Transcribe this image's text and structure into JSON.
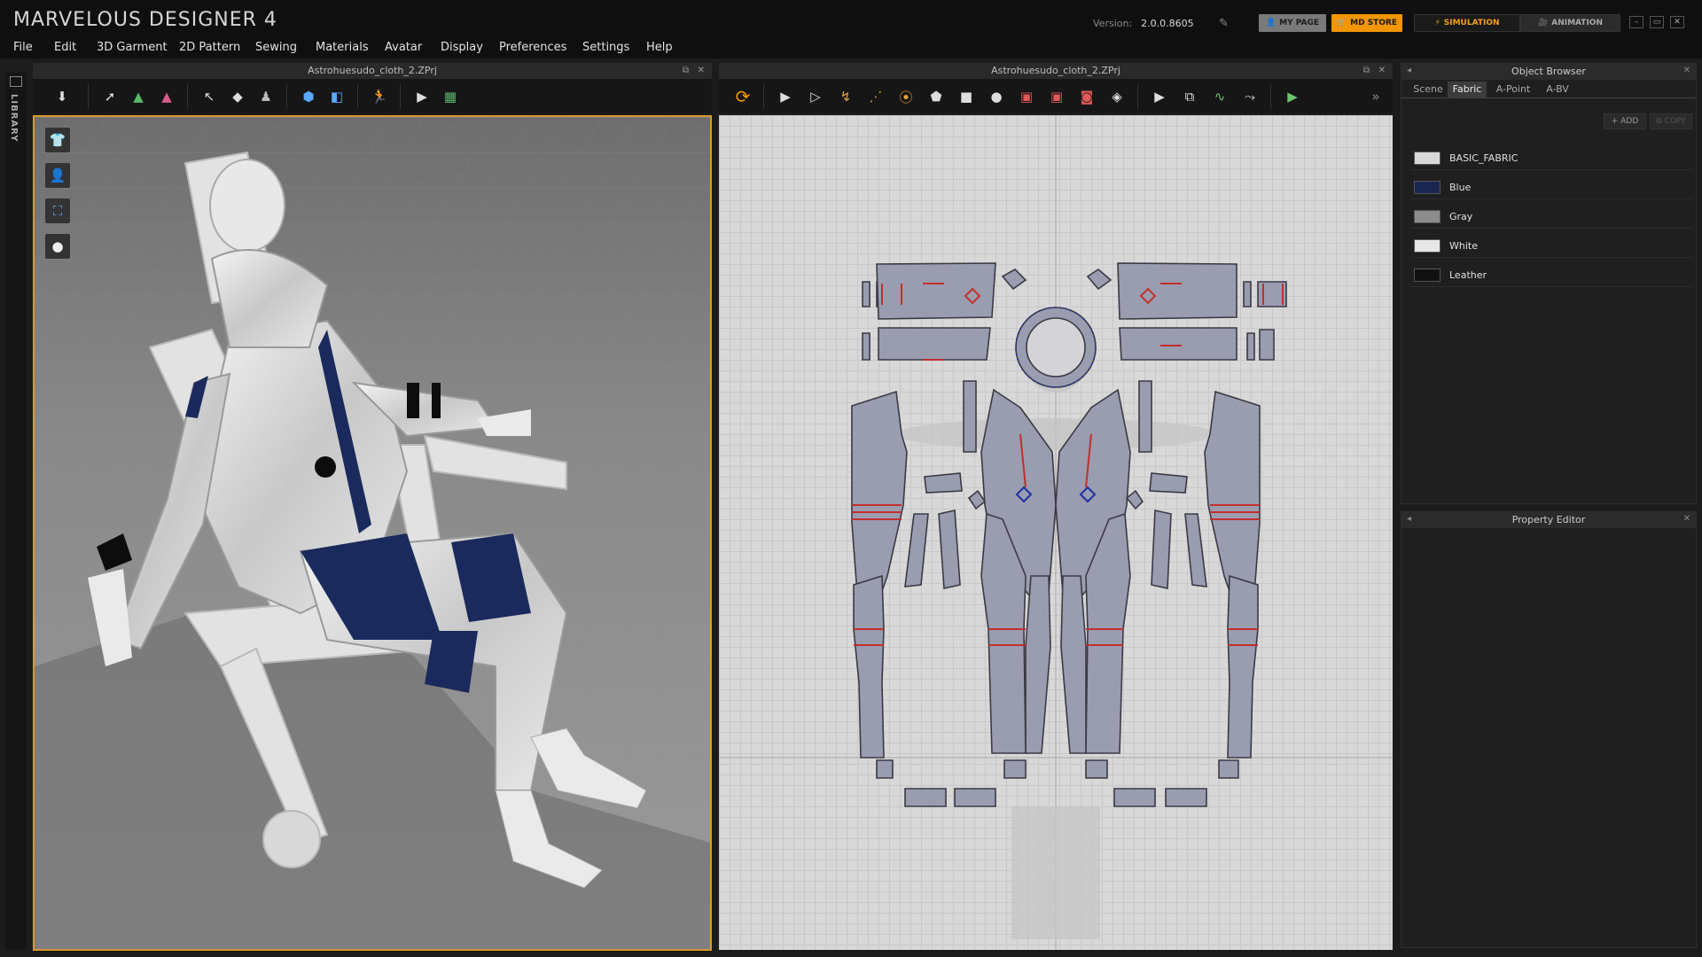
{
  "app": {
    "title": "MARVELOUS DESIGNER 4",
    "version_label": "Version:",
    "version": "2.0.0.8605",
    "buttons": {
      "my_page": "MY PAGE",
      "md_store": "MD STORE",
      "simulation": "SIMULATION",
      "animation": "ANIMATION"
    }
  },
  "menu": [
    "File",
    "Edit",
    "3D Garment",
    "2D Pattern",
    "Sewing",
    "Materials",
    "Avatar",
    "Display",
    "Preferences",
    "Settings",
    "Help"
  ],
  "library": {
    "label": "LIBRARY"
  },
  "panel3d": {
    "title": "Astrohuesudo_cloth_2.ZPrj"
  },
  "panel2d": {
    "title": "Astrohuesudo_cloth_2.ZPrj"
  },
  "object_browser": {
    "title": "Object Browser",
    "tabs": [
      "Scene",
      "Fabric",
      "A-Point",
      "A-BV"
    ],
    "active_tab": "Fabric",
    "add_label": "ADD",
    "copy_label": "COPY",
    "fabrics": [
      {
        "name": "BASIC_FABRIC",
        "color": "#d9d9d9"
      },
      {
        "name": "Blue",
        "color": "#1a2550"
      },
      {
        "name": "Gray",
        "color": "#8c8c8c"
      },
      {
        "name": "White",
        "color": "#e6e6e6"
      },
      {
        "name": "Leather",
        "color": "#111111"
      }
    ]
  },
  "property_editor": {
    "title": "Property Editor"
  },
  "colors": {
    "accent": "#f29600",
    "viewport_border": "#d99a2b",
    "pattern_fill": "#9a9cb0",
    "seam_red": "#c0302c"
  }
}
